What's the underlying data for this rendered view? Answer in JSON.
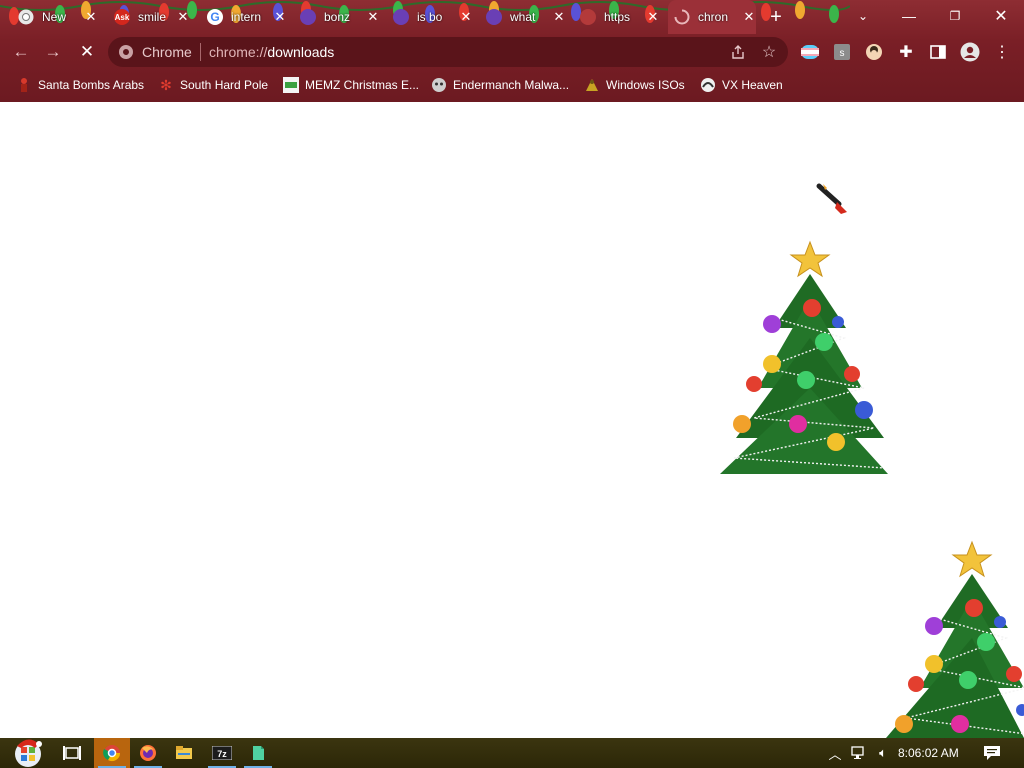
{
  "tabs": [
    {
      "title": "New",
      "icon": "chrome-icon"
    },
    {
      "title": "smile",
      "icon": "ask-icon"
    },
    {
      "title": "intern",
      "icon": "google-icon"
    },
    {
      "title": "bonz",
      "icon": "bonzi-icon"
    },
    {
      "title": "is bo",
      "icon": "bonzi-icon"
    },
    {
      "title": "what",
      "icon": "bonzi-icon"
    },
    {
      "title": "https",
      "icon": "page-icon"
    },
    {
      "title": "chron",
      "icon": "loading-spinner-icon",
      "active": true
    }
  ],
  "toolbar": {
    "chip": "Chrome",
    "url_scheme": "chrome://",
    "url_host": "downloads"
  },
  "bookmarks": [
    "Santa Bombs Arabs",
    "South Hard Pole",
    "MEMZ Christmas E...",
    "Endermanch Malwa...",
    "Windows ISOs",
    "VX Heaven"
  ],
  "taskbar": {
    "time": "8:06:02 AM"
  },
  "colors": {
    "frame": "#7a1f26",
    "omnibox": "#5a141a",
    "taskbar": "#2c2707",
    "active_taskbar_app": "#b8650e"
  }
}
